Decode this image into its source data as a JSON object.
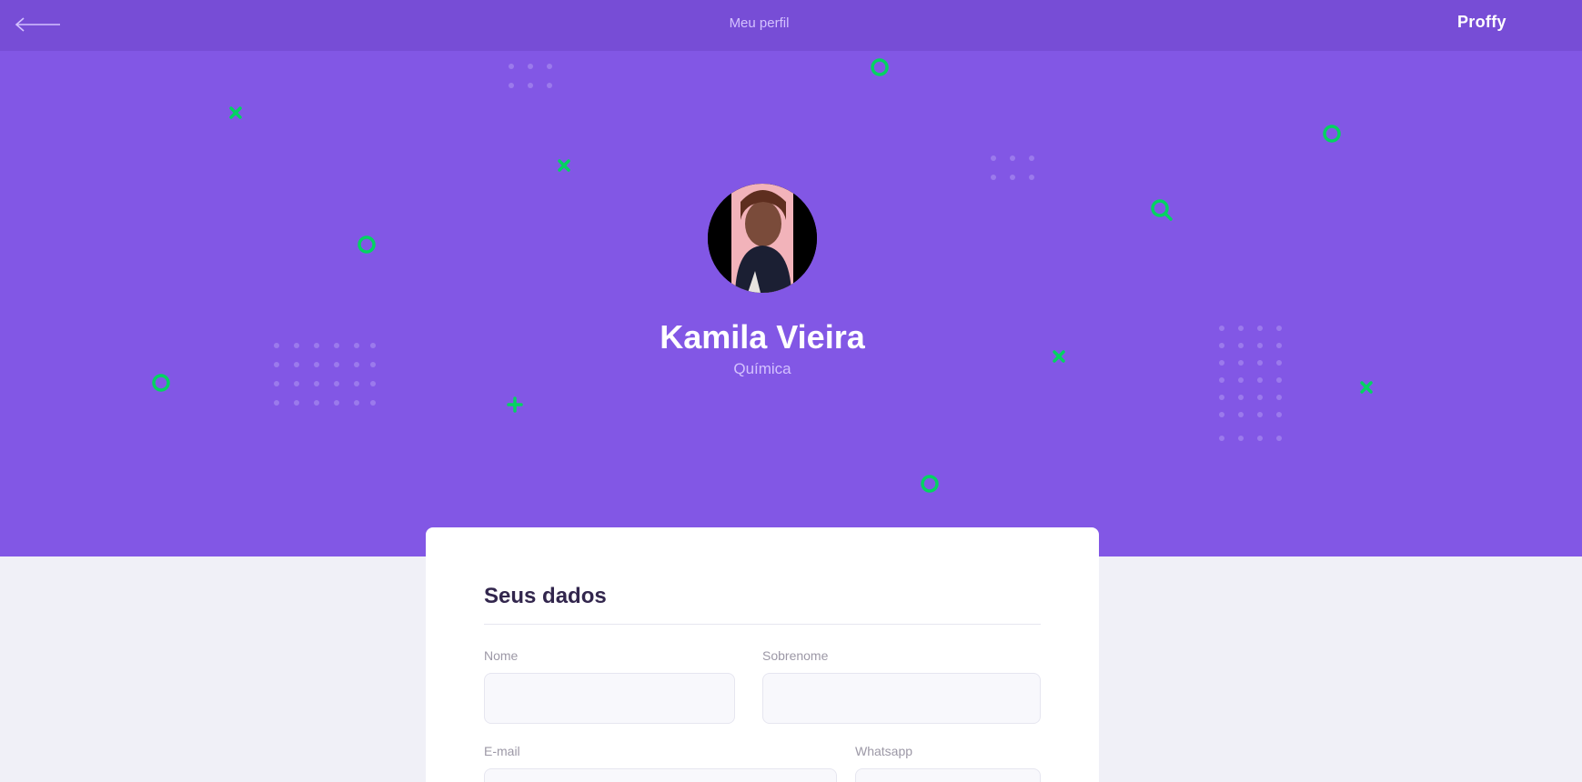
{
  "header": {
    "title": "Meu perfil",
    "logo": "Proffy",
    "back_icon": "arrow-left-icon"
  },
  "profile": {
    "name": "Kamila Vieira",
    "subject": "Química",
    "avatar_icon": "avatar-photo"
  },
  "form": {
    "section_title": "Seus dados",
    "fields": {
      "first_name": {
        "label": "Nome",
        "value": ""
      },
      "last_name": {
        "label": "Sobrenome",
        "value": ""
      },
      "email": {
        "label": "E-mail",
        "value": ""
      },
      "whatsapp": {
        "label": "Whatsapp",
        "value": ""
      }
    }
  },
  "colors": {
    "topbar": "#774DD6",
    "hero": "#8257E5",
    "accent_green": "#04D361",
    "page_background": "#F0F0F7",
    "card": "#FFFFFF",
    "title_text": "#32264D",
    "muted_text": "#9C98A6"
  }
}
